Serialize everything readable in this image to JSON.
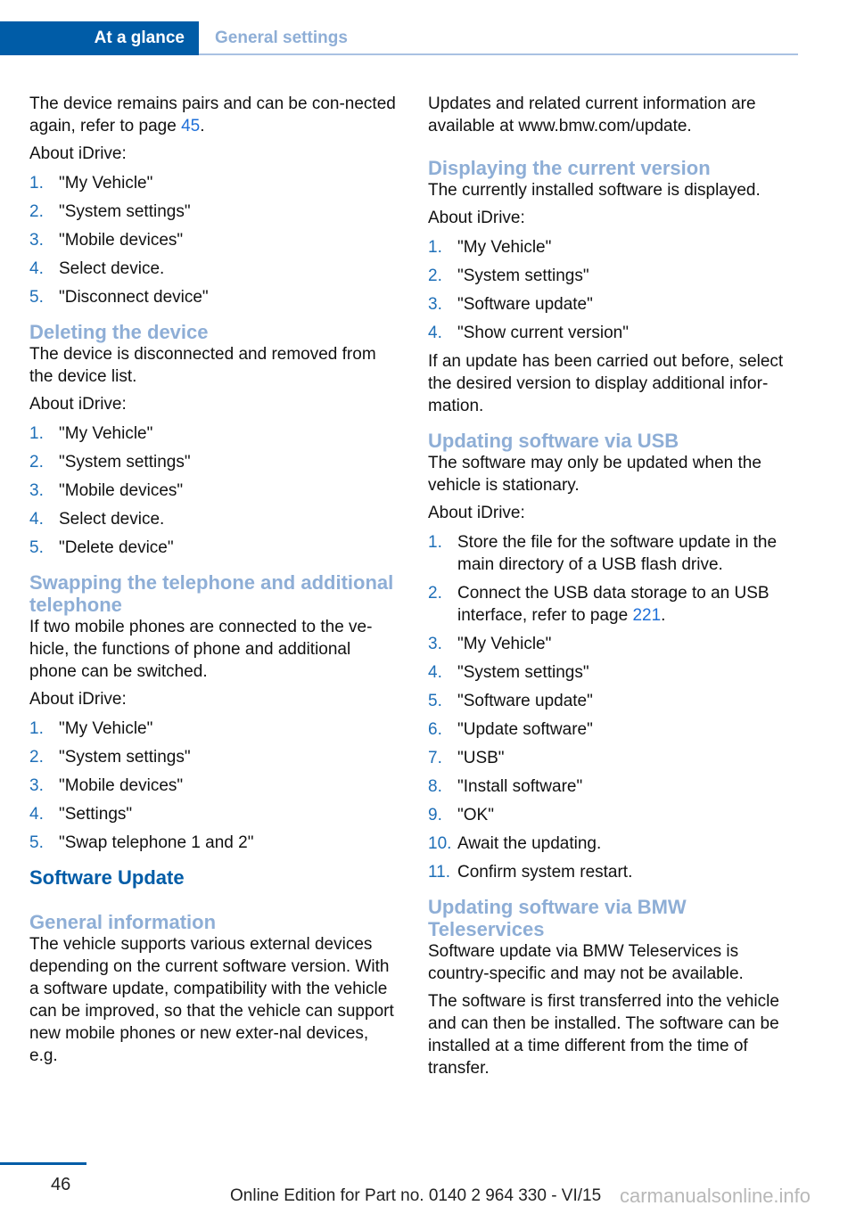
{
  "header": {
    "tabs": [
      {
        "label": "At a glance",
        "active": true
      },
      {
        "label": "General settings",
        "active": false
      }
    ],
    "colors": {
      "active_bg": "#005ca7",
      "inactive_text": "#8eaed6",
      "link": "#1e6fd9"
    }
  },
  "left": {
    "intro": {
      "text_before": "The device remains pairs and can be con-nected again, refer to page ",
      "page_ref": "45",
      "text_after": "."
    },
    "about1": "About iDrive:",
    "steps1": [
      {
        "n": "1.",
        "t": "\"My Vehicle\""
      },
      {
        "n": "2.",
        "t": "\"System settings\""
      },
      {
        "n": "3.",
        "t": "\"Mobile devices\""
      },
      {
        "n": "4.",
        "t": "Select device."
      },
      {
        "n": "5.",
        "t": "\"Disconnect device\""
      }
    ],
    "delete": {
      "heading": "Deleting the device",
      "text": "The device is disconnected and removed from the device list.",
      "about": "About iDrive:",
      "steps": [
        {
          "n": "1.",
          "t": "\"My Vehicle\""
        },
        {
          "n": "2.",
          "t": "\"System settings\""
        },
        {
          "n": "3.",
          "t": "\"Mobile devices\""
        },
        {
          "n": "4.",
          "t": "Select device."
        },
        {
          "n": "5.",
          "t": "\"Delete device\""
        }
      ]
    },
    "swap": {
      "heading": "Swapping the telephone and additional telephone",
      "text": "If two mobile phones are connected to the ve-hicle, the functions of phone and additional phone can be switched.",
      "about": "About iDrive:",
      "steps": [
        {
          "n": "1.",
          "t": "\"My Vehicle\""
        },
        {
          "n": "2.",
          "t": "\"System settings\""
        },
        {
          "n": "3.",
          "t": "\"Mobile devices\""
        },
        {
          "n": "4.",
          "t": "\"Settings\""
        },
        {
          "n": "5.",
          "t": "\"Swap telephone 1 and 2\""
        }
      ]
    },
    "software_update": {
      "heading": "Software Update",
      "general_heading": "General information",
      "general_text": "The vehicle supports various external devices depending on the current software version. With a software update, compatibility with the vehicle can be improved, so that the vehicle can support new mobile phones or new exter-nal devices, e.g."
    }
  },
  "right": {
    "intro": "Updates and related current information are available at www.bmw.com/update.",
    "current_version": {
      "heading": "Displaying the current version",
      "text": "The currently installed software is displayed.",
      "about": "About iDrive:",
      "steps": [
        {
          "n": "1.",
          "t": "\"My Vehicle\""
        },
        {
          "n": "2.",
          "t": "\"System settings\""
        },
        {
          "n": "3.",
          "t": "\"Software update\""
        },
        {
          "n": "4.",
          "t": "\"Show current version\""
        }
      ],
      "after": "If an update has been carried out before, select the desired version to display additional infor-mation."
    },
    "usb": {
      "heading": "Updating software via USB",
      "text": "The software may only be updated when the vehicle is stationary.",
      "about": "About iDrive:",
      "step1": {
        "n": "1.",
        "t": "Store the file for the software update in the main directory of a USB flash drive."
      },
      "step2": {
        "n": "2.",
        "t_before": "Connect the USB data storage to an USB interface, refer to page ",
        "page_ref": "221",
        "t_after": "."
      },
      "steps_rest": [
        {
          "n": "3.",
          "t": "\"My Vehicle\""
        },
        {
          "n": "4.",
          "t": "\"System settings\""
        },
        {
          "n": "5.",
          "t": "\"Software update\""
        },
        {
          "n": "6.",
          "t": "\"Update software\""
        },
        {
          "n": "7.",
          "t": "\"USB\""
        },
        {
          "n": "8.",
          "t": "\"Install software\""
        },
        {
          "n": "9.",
          "t": "\"OK\""
        },
        {
          "n": "10.",
          "t": "Await the updating."
        },
        {
          "n": "11.",
          "t": "Confirm system restart."
        }
      ]
    },
    "teleservices": {
      "heading": "Updating software via BMW Teleservices",
      "text1": "Software update via BMW Teleservices is country-specific and may not be available.",
      "text2": "The software is first transferred into the vehicle and can then be installed. The software can be installed at a time different from the time of transfer."
    }
  },
  "footer": {
    "page_number": "46",
    "edition": "Online Edition for Part no. 0140 2 964 330 - VI/15",
    "watermark": "carmanualsonline.info"
  }
}
